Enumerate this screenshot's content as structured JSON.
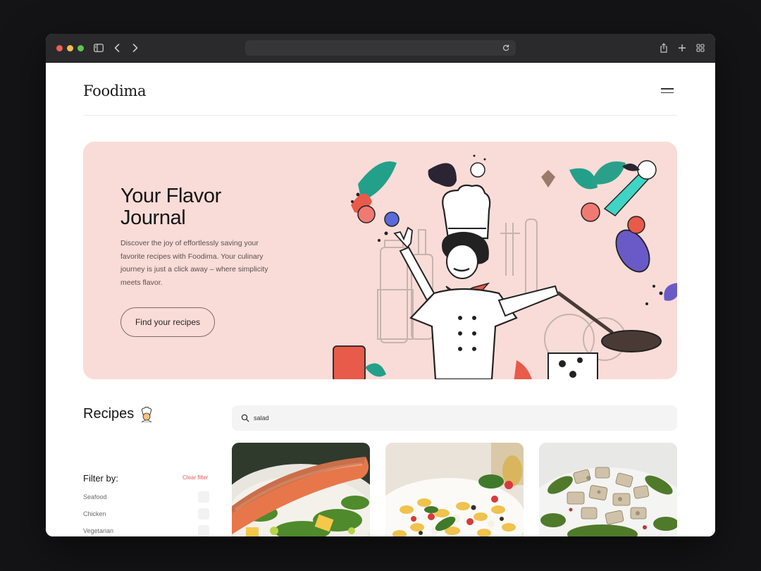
{
  "browser": {
    "traffic_lights": [
      "close",
      "minimize",
      "zoom"
    ],
    "icons": [
      "sidebar-icon",
      "back-icon",
      "forward-icon",
      "reload-icon",
      "share-icon",
      "new-tab-icon",
      "tab-overview-icon"
    ],
    "url": ""
  },
  "site": {
    "brand": "Foodima",
    "menu_icon": "hamburger-menu-icon"
  },
  "hero": {
    "title": "Your Flavor Journal",
    "description": "Discover the joy of effortlessly saving your favorite recipes with Foodima. Your culinary journey is just a click away – where simplicity meets flavor.",
    "cta_label": "Find your recipes",
    "background_color": "#f9dcd7",
    "illustration": "chef-illustration"
  },
  "recipes": {
    "title": "Recipes",
    "title_icon": "chef-emoji-icon",
    "filter_label": "Filter by:",
    "clear_filter_label": "Clear filter",
    "filters": [
      {
        "label": "Seafood",
        "checked": false
      },
      {
        "label": "Chicken",
        "checked": false
      },
      {
        "label": "Vegetarian",
        "checked": false
      }
    ],
    "search": {
      "value": "salad",
      "placeholder": ""
    },
    "cards": [
      {
        "image": "salmon-salad-photo"
      },
      {
        "image": "pasta-salad-photo"
      },
      {
        "image": "chicken-salad-photo"
      }
    ]
  },
  "colors": {
    "accent": "#e75a5a",
    "text": "#151515",
    "page_bg": "#141416"
  }
}
